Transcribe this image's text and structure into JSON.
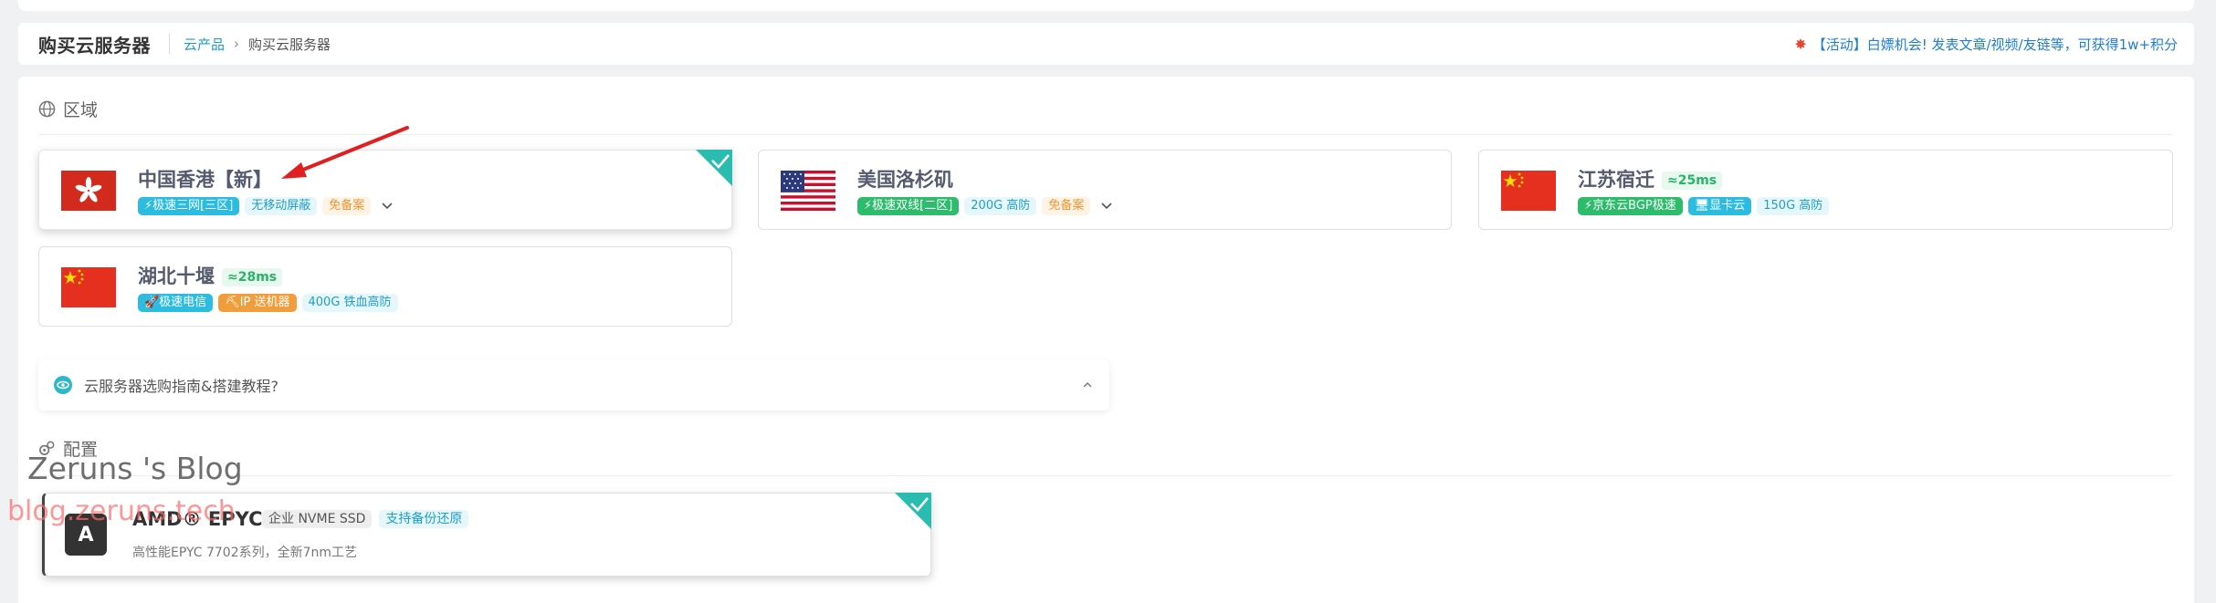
{
  "header": {
    "title": "购买云服务器",
    "breadcrumb_parent": "云产品",
    "breadcrumb_current": "购买云服务器",
    "promo_icon": "firework-icon",
    "promo_text": "【活动】白嫖机会! 发表文章/视频/友链等，可获得1w+积分"
  },
  "region": {
    "section_label": "区域",
    "cards": [
      {
        "name": "中国香港【新】",
        "latency": "",
        "tags": [
          "⚡极速三网[三区]",
          "无移动屏蔽",
          "免备案"
        ],
        "selected": true
      },
      {
        "name": "美国洛杉矶",
        "latency": "",
        "tags": [
          "⚡极速双线[二区]",
          "200G 高防",
          "免备案"
        ],
        "selected": false
      },
      {
        "name": "江苏宿迁",
        "latency": "≈25ms",
        "tags": [
          "⚡京东云BGP极速",
          "🖥显卡云",
          "150G 高防"
        ],
        "selected": false
      },
      {
        "name": "湖北十堰",
        "latency": "≈28ms",
        "tags": [
          "🚀极速电信",
          "⛏IP 送机器",
          "400G 铁血高防"
        ],
        "selected": false
      }
    ]
  },
  "guide": {
    "text": "云服务器选购指南&搭建教程?"
  },
  "config": {
    "section_label": "配置",
    "cpu": {
      "badge": "A",
      "name": "AMD® EPYC",
      "tags": [
        "企业 NVME SSD",
        "支持备份还原"
      ],
      "desc": "高性能EPYC 7702系列，全新7nm工艺",
      "selected": true
    }
  },
  "watermark": {
    "title": "Zeruns 's Blog",
    "url": "blog.zeruns.tech"
  },
  "colors": {
    "accent": "#2bbcb0",
    "link": "#1e9ec8",
    "arrow": "#e02020"
  }
}
